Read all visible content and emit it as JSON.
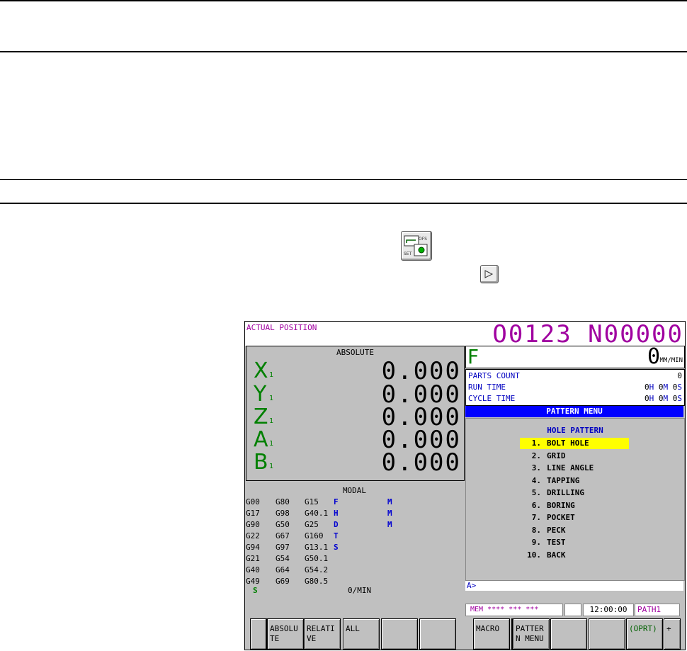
{
  "screen": {
    "title": "ACTUAL POSITION",
    "program": "O0123 N00000"
  },
  "position": {
    "header": "ABSOLUTE",
    "axes": [
      {
        "name": "X",
        "sub": "1",
        "value": "0.000"
      },
      {
        "name": "Y",
        "sub": "1",
        "value": "0.000"
      },
      {
        "name": "Z",
        "sub": "1",
        "value": "0.000"
      },
      {
        "name": "A",
        "sub": "1",
        "value": "0.000"
      },
      {
        "name": "B",
        "sub": "1",
        "value": "0.000"
      }
    ]
  },
  "feed": {
    "label": "F",
    "value": "0",
    "unit": "MM/MIN"
  },
  "counts": {
    "parts_label": "PARTS COUNT",
    "parts_value": "0",
    "run_label": "RUN TIME",
    "run_h": "0",
    "run_h_unit": "H",
    "run_m": "0",
    "run_m_unit": "M",
    "run_s": "0",
    "run_s_unit": "S",
    "cycle_label": "CYCLE TIME",
    "cycle_h": "0",
    "cycle_h_unit": "H",
    "cycle_m": "0",
    "cycle_m_unit": "M",
    "cycle_s": "0",
    "cycle_s_unit": "S"
  },
  "modal": {
    "header": "MODAL",
    "gcodes": [
      [
        "G00",
        "G80",
        "G15"
      ],
      [
        "G17",
        "G98",
        "G40.1"
      ],
      [
        "G90",
        "G50",
        "G25"
      ],
      [
        "G22",
        "G67",
        "G160"
      ],
      [
        "G94",
        "G97",
        "G13.1"
      ],
      [
        "G21",
        "G54",
        "G50.1"
      ],
      [
        "G40",
        "G64",
        "G54.2"
      ],
      [
        "G49",
        "G69",
        "G80.5"
      ]
    ],
    "flags": [
      "F",
      "H",
      "D",
      "T",
      "S"
    ],
    "m_flags": [
      "M",
      "M",
      "M"
    ],
    "spindle_label": "S",
    "spindle_value": "0/MIN"
  },
  "pattern_menu": {
    "title": "PATTERN MENU",
    "subtitle": "HOLE PATTERN",
    "items": [
      {
        "num": "1.",
        "label": "BOLT HOLE"
      },
      {
        "num": "2.",
        "label": "GRID"
      },
      {
        "num": "3.",
        "label": "LINE ANGLE"
      },
      {
        "num": "4.",
        "label": "TAPPING"
      },
      {
        "num": "5.",
        "label": "DRILLING"
      },
      {
        "num": "6.",
        "label": "BORING"
      },
      {
        "num": "7.",
        "label": "POCKET"
      },
      {
        "num": "8.",
        "label": "PECK"
      },
      {
        "num": "9.",
        "label": "TEST"
      },
      {
        "num": "10.",
        "label": "BACK"
      }
    ]
  },
  "input": {
    "prompt": "A>"
  },
  "status": {
    "mode": "MEM **** *** ***",
    "time": "12:00:00",
    "path": "PATH1"
  },
  "softkeys": {
    "k1": "",
    "k2": "ABSOLUTE",
    "k3": "RELATIVE",
    "k4": "ALL",
    "k5": "",
    "k6": "",
    "k7": "MACRO",
    "k8": "PATTERN MENU",
    "k9": "",
    "k10": "",
    "k11": "(OPRT)",
    "k12": "+"
  },
  "colors": {
    "title": "#a000a0",
    "axis": "#008000",
    "menu_title_bg": "#0000ff",
    "highlight": "#ffff00"
  }
}
